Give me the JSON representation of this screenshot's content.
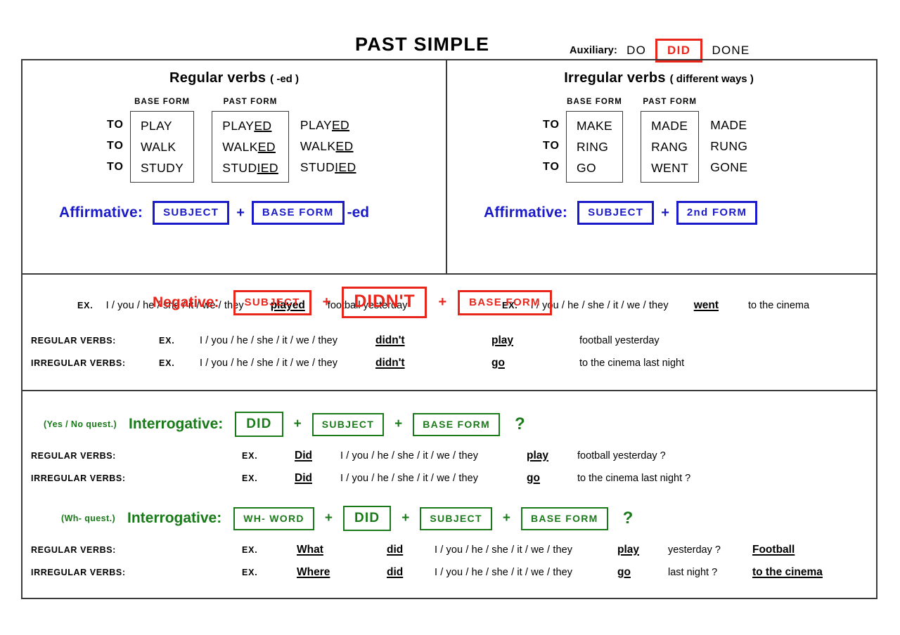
{
  "header": {
    "title": "PAST SIMPLE",
    "auxiliary_label": "Auxiliary:",
    "aux_do": "DO",
    "aux_did": "DID",
    "aux_done": "DONE",
    "aux_highlight_color": "#e8261c"
  },
  "colors": {
    "blue": "#1a1ac8",
    "red": "#e8261c",
    "green": "#1a7a1a",
    "border": "#3a3a3a"
  },
  "regular": {
    "title": "Regular verbs",
    "title_note": "( -ed )",
    "col_head_base": "BASE FORM",
    "col_head_past": "PAST FORM",
    "to": [
      "TO",
      "TO",
      "TO"
    ],
    "base": [
      "PLAY",
      "WALK",
      "STUDY"
    ],
    "past": [
      {
        "stem": "PLAY",
        "suffix": "ED"
      },
      {
        "stem": "WALK",
        "suffix": "ED"
      },
      {
        "stem": "STUD",
        "suffix": "IED"
      }
    ],
    "participle": [
      {
        "stem": "PLAY",
        "suffix": "ED"
      },
      {
        "stem": "WALK",
        "suffix": "ED"
      },
      {
        "stem": "STUD",
        "suffix": "IED"
      }
    ],
    "affirmative": {
      "label": "Affirmative:",
      "box1": "SUBJECT",
      "plus": "+",
      "box2": "BASE FORM",
      "suffix": "-ed"
    },
    "example": {
      "tag": "EX.",
      "subject": "I / you / he / she / it / we / they",
      "verb": "played",
      "rest": "football yesterday"
    }
  },
  "irregular": {
    "title": "Irregular verbs",
    "title_note": "( different ways )",
    "col_head_base": "BASE FORM",
    "col_head_past": "PAST FORM",
    "to": [
      "TO",
      "TO",
      "TO"
    ],
    "base": [
      "MAKE",
      "RING",
      "GO"
    ],
    "past": [
      {
        "stem": "MADE",
        "suffix": ""
      },
      {
        "stem": "RANG",
        "suffix": ""
      },
      {
        "stem": "WENT",
        "suffix": ""
      }
    ],
    "participle": [
      {
        "stem": "MADE",
        "suffix": ""
      },
      {
        "stem": "RUNG",
        "suffix": ""
      },
      {
        "stem": "GONE",
        "suffix": ""
      }
    ],
    "affirmative": {
      "label": "Affirmative:",
      "box1": "SUBJECT",
      "plus": "+",
      "box2": "2nd FORM",
      "suffix": ""
    },
    "example": {
      "tag": "EX.",
      "subject": "I / you / he / she / it / we / they",
      "verb": "went",
      "rest": "to the cinema"
    }
  },
  "negative": {
    "label": "Negative:",
    "box1": "SUBJECT",
    "plus1": "+",
    "box2": "DIDN'T",
    "plus2": "+",
    "box3": "BASE FORM",
    "rows": [
      {
        "label": "REGULAR VERBS:",
        "tag": "EX.",
        "subject": "I / you / he / she / it / we / they",
        "aux": "didn't",
        "verb": "play",
        "rest": "football yesterday"
      },
      {
        "label": "IRREGULAR VERBS:",
        "tag": "EX.",
        "subject": "I / you / he / she / it / we / they",
        "aux": "didn't",
        "verb": "go",
        "rest": "to the cinema last night"
      }
    ]
  },
  "interrogative_yesno": {
    "hint": "(Yes / No quest.)",
    "label": "Interrogative:",
    "box1": "DID",
    "plus1": "+",
    "box2": "SUBJECT",
    "plus2": "+",
    "box3": "BASE FORM",
    "qmark": "?",
    "rows": [
      {
        "label": "REGULAR VERBS:",
        "tag": "EX.",
        "aux": "Did",
        "subject": "I / you / he / she / it / we / they",
        "verb": "play",
        "rest": "football yesterday  ?"
      },
      {
        "label": "IRREGULAR VERBS:",
        "tag": "EX.",
        "aux": "Did",
        "subject": "I / you / he / she / it / we / they",
        "verb": "go",
        "rest": "to the cinema last night  ?"
      }
    ]
  },
  "interrogative_wh": {
    "hint": "(Wh- quest.)",
    "label": "Interrogative:",
    "box0": "WH-  WORD",
    "plus0": "+",
    "box1": "DID",
    "plus1": "+",
    "box2": "SUBJECT",
    "plus2": "+",
    "box3": "BASE FORM",
    "qmark": "?",
    "rows": [
      {
        "label": "REGULAR VERBS:",
        "tag": "EX.",
        "wh": "What",
        "aux": "did",
        "subject": "I / you / he / she / it / we / they",
        "verb": "play",
        "rest": "yesterday  ?",
        "answer": "Football"
      },
      {
        "label": "IRREGULAR VERBS:",
        "tag": "EX.",
        "wh": "Where",
        "aux": "did",
        "subject": "I / you / he / she / it / we / they",
        "verb": "go",
        "rest": "last night  ?",
        "answer": "to the cinema"
      }
    ]
  }
}
